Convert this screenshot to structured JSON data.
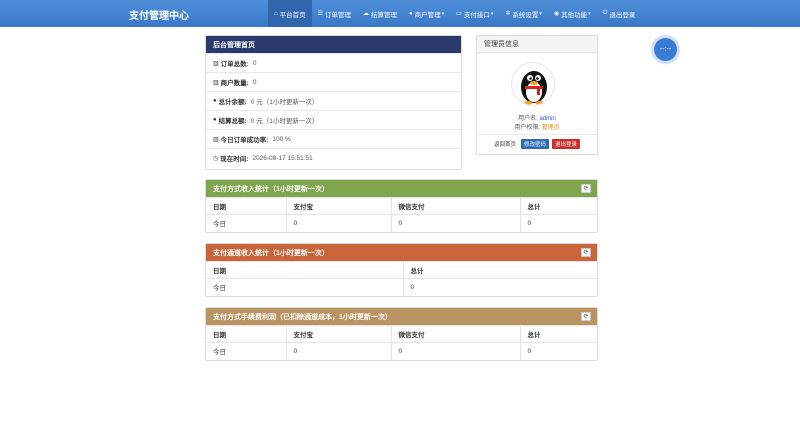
{
  "navbar": {
    "brand": "支付管理中心",
    "items": [
      {
        "label": "平台首页",
        "icon": "home-icon",
        "glyph": "⌂",
        "active": true,
        "caret": false
      },
      {
        "label": "订单管理",
        "icon": "list-icon",
        "glyph": "☰",
        "active": false,
        "caret": false
      },
      {
        "label": "结算管理",
        "icon": "cloud-icon",
        "glyph": "☁",
        "active": false,
        "caret": false
      },
      {
        "label": "商户管理",
        "icon": "user-icon",
        "glyph": "●",
        "active": false,
        "caret": true
      },
      {
        "label": "支付接口",
        "icon": "card-icon",
        "glyph": "▭",
        "active": false,
        "caret": true
      },
      {
        "label": "系统设置",
        "icon": "gear-icon",
        "glyph": "✲",
        "active": false,
        "caret": true
      },
      {
        "label": "其他功能",
        "icon": "globe-icon",
        "glyph": "◉",
        "active": false,
        "caret": true
      },
      {
        "label": "退出登录",
        "icon": "power-icon",
        "glyph": "⏻",
        "active": false,
        "caret": false
      }
    ]
  },
  "float_button": {
    "label": "--:--"
  },
  "admin_home": {
    "title": "后台管理首页",
    "rows": [
      {
        "icon": "bar-chart-icon",
        "glyph": "▥",
        "label": "订单总数:",
        "value": "0"
      },
      {
        "icon": "bar-chart-icon",
        "glyph": "▥",
        "label": "商户数量:",
        "value": "0"
      },
      {
        "icon": "drop-icon",
        "glyph": "●",
        "label": "总计余额:",
        "value": "0 元（1小时更新一次）"
      },
      {
        "icon": "drop-icon",
        "glyph": "●",
        "label": "结算总额:",
        "value": "0 元（1小时更新一次）"
      },
      {
        "icon": "bar-chart-icon",
        "glyph": "▥",
        "label": "今日订单成功率:",
        "value": "100 %"
      },
      {
        "icon": "clock-icon",
        "glyph": "◷",
        "label": "现在时间:",
        "value": "2026-08-17 15:51:51"
      }
    ]
  },
  "admin_info": {
    "title": "管理员信息",
    "username_label": "用户名:",
    "username": "admin",
    "role_label": "用户权限:",
    "role": "管理员",
    "back_link": "返回首页",
    "change_password": "修改密码",
    "logout": "退出登录"
  },
  "colors": {
    "green_header": "#7fa54f",
    "orange_header": "#c8653b",
    "tan_header": "#b99462",
    "navy_header": "#2b3a6b"
  },
  "pay_method_income": {
    "title": "支付方式收入统计（1小时更新一次）",
    "headers": [
      "日期",
      "支付宝",
      "微信支付",
      "总计"
    ],
    "rows": [
      [
        "今日",
        "0",
        "0",
        "0"
      ]
    ]
  },
  "channel_income": {
    "title": "支付通道收入统计（1小时更新一次）",
    "headers": [
      "日期",
      "总计"
    ],
    "rows": [
      [
        "今日",
        "0"
      ]
    ]
  },
  "fee_profit": {
    "title": "支付方式手续费利润（已扣除通道成本，1小时更新一次）",
    "headers": [
      "日期",
      "支付宝",
      "微信支付",
      "总计"
    ],
    "rows": [
      [
        "今日",
        "0",
        "0",
        "0"
      ]
    ]
  }
}
